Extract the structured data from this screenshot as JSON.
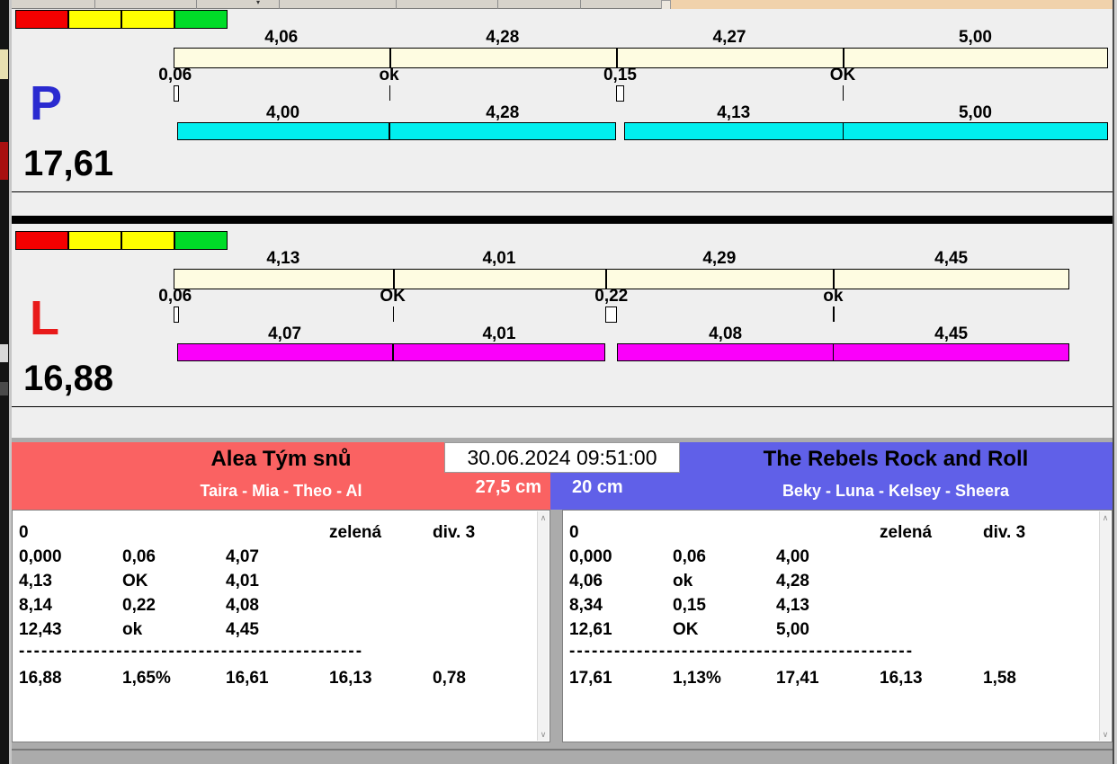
{
  "chrome": {
    "peach_color": "#F0D2AC",
    "scrollbar": {
      "up": "∧",
      "down": "∨"
    }
  },
  "traffic_light_colors": [
    "#F40000",
    "#FFFF00",
    "#FFFF00",
    "#00DC28"
  ],
  "gross_bar_color": "#FEFCE1",
  "lanes": [
    {
      "letter": "P",
      "letter_color": "#2A2AD0",
      "total_label": "17,61",
      "total_seconds": 17.61,
      "gross_segments": [
        {
          "label": "4,06",
          "seconds": 4.06
        },
        {
          "label": "4,28",
          "seconds": 4.28
        },
        {
          "label": "4,27",
          "seconds": 4.27
        },
        {
          "label": "5,00",
          "seconds": 5.0
        }
      ],
      "losses": [
        {
          "label": "0,06",
          "seconds": 0.06
        },
        {
          "label": "ok",
          "seconds": 0
        },
        {
          "label": "0,15",
          "seconds": 0.15
        },
        {
          "label": "OK",
          "seconds": 0
        }
      ],
      "net_segments": [
        {
          "label": "4,00",
          "seconds": 4.0
        },
        {
          "label": "4,28",
          "seconds": 4.28
        },
        {
          "label": "4,13",
          "seconds": 4.13
        },
        {
          "label": "5,00",
          "seconds": 5.0
        }
      ],
      "net_color": "#00EFEF"
    },
    {
      "letter": "L",
      "letter_color": "#E81A1A",
      "total_label": "16,88",
      "total_seconds": 16.88,
      "gross_segments": [
        {
          "label": "4,13",
          "seconds": 4.13
        },
        {
          "label": "4,01",
          "seconds": 4.01
        },
        {
          "label": "4,29",
          "seconds": 4.29
        },
        {
          "label": "4,45",
          "seconds": 4.45
        }
      ],
      "losses": [
        {
          "label": "0,06",
          "seconds": 0.06
        },
        {
          "label": "OK",
          "seconds": 0
        },
        {
          "label": "0,22",
          "seconds": 0.22
        },
        {
          "label": "ok",
          "seconds": 0
        }
      ],
      "net_segments": [
        {
          "label": "4,07",
          "seconds": 4.07
        },
        {
          "label": "4,01",
          "seconds": 4.01
        },
        {
          "label": "4,08",
          "seconds": 4.08
        },
        {
          "label": "4,45",
          "seconds": 4.45
        }
      ],
      "net_color": "#FA00FA"
    }
  ],
  "scoreboard": {
    "datetime": "30.06.2024 09:51:00",
    "left_team": {
      "name": "Alea Tým snů",
      "dogs": "Taira - Mia - Theo - Al",
      "jump_height": "27,5 cm",
      "header_color": "#FA6262",
      "rows": [
        [
          "0",
          "",
          "",
          "zelená",
          "div. 3"
        ],
        [
          "0,000",
          "0,06",
          "4,07",
          "",
          ""
        ],
        [
          "4,13",
          "OK",
          "4,01",
          "",
          ""
        ],
        [
          "8,14",
          "0,22",
          "4,08",
          "",
          ""
        ],
        [
          "12,43",
          "ok",
          "4,45",
          "",
          ""
        ]
      ],
      "divider": "----------------------------------------------",
      "summary": [
        "16,88",
        "1,65%",
        "16,61",
        "16,13",
        "0,78"
      ]
    },
    "right_team": {
      "name": "The Rebels Rock and Roll",
      "dogs": "Beky - Luna - Kelsey - Sheera",
      "jump_height": "20 cm",
      "header_color": "#6060E8",
      "rows": [
        [
          "0",
          "",
          "",
          "zelená",
          "div. 3"
        ],
        [
          "0,000",
          "0,06",
          "4,00",
          "",
          ""
        ],
        [
          "4,06",
          "ok",
          "4,28",
          "",
          ""
        ],
        [
          "8,34",
          "0,15",
          "4,13",
          "",
          ""
        ],
        [
          "12,61",
          "OK",
          "5,00",
          "",
          ""
        ]
      ],
      "divider": "----------------------------------------------",
      "summary": [
        "17,61",
        "1,13%",
        "17,41",
        "16,13",
        "1,58"
      ]
    }
  }
}
